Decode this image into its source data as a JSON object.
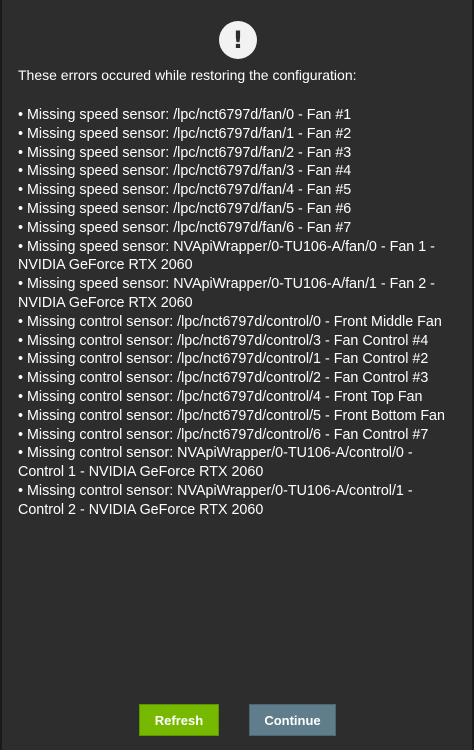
{
  "dialog": {
    "icon": "exclamation-icon",
    "icon_glyph": "!",
    "heading": "These errors occured while restoring the configuration:",
    "errors": [
      "Missing speed sensor: /lpc/nct6797d/fan/0 - Fan #1",
      "Missing speed sensor: /lpc/nct6797d/fan/1 - Fan #2",
      "Missing speed sensor: /lpc/nct6797d/fan/2 - Fan #3",
      "Missing speed sensor: /lpc/nct6797d/fan/3 - Fan #4",
      "Missing speed sensor: /lpc/nct6797d/fan/4 - Fan #5",
      "Missing speed sensor: /lpc/nct6797d/fan/5 - Fan #6",
      "Missing speed sensor: /lpc/nct6797d/fan/6 - Fan #7",
      "Missing speed sensor: NVApiWrapper/0-TU106-A/fan/0 - Fan 1 - NVIDIA GeForce RTX 2060",
      "Missing speed sensor: NVApiWrapper/0-TU106-A/fan/1 - Fan 2 - NVIDIA GeForce RTX 2060",
      "Missing control sensor: /lpc/nct6797d/control/0 - Front Middle Fan",
      "Missing control sensor: /lpc/nct6797d/control/3 - Fan Control #4",
      "Missing control sensor: /lpc/nct6797d/control/1 - Fan Control #2",
      "Missing control sensor: /lpc/nct6797d/control/2 - Fan Control #3",
      "Missing control sensor: /lpc/nct6797d/control/4 - Front Top Fan",
      "Missing control sensor: /lpc/nct6797d/control/5 - Front Bottom Fan",
      "Missing control sensor: /lpc/nct6797d/control/6 - Fan Control #7",
      "Missing control sensor: NVApiWrapper/0-TU106-A/control/0 - Control 1 - NVIDIA GeForce RTX 2060",
      "Missing control sensor: NVApiWrapper/0-TU106-A/control/1 - Control 2 - NVIDIA GeForce RTX 2060"
    ],
    "buttons": {
      "refresh_label": "Refresh",
      "continue_label": "Continue"
    }
  },
  "colors": {
    "background": "#2d2d2d",
    "refresh_button": "#76b900",
    "continue_button": "#607d8b",
    "text": "#ffffff"
  }
}
